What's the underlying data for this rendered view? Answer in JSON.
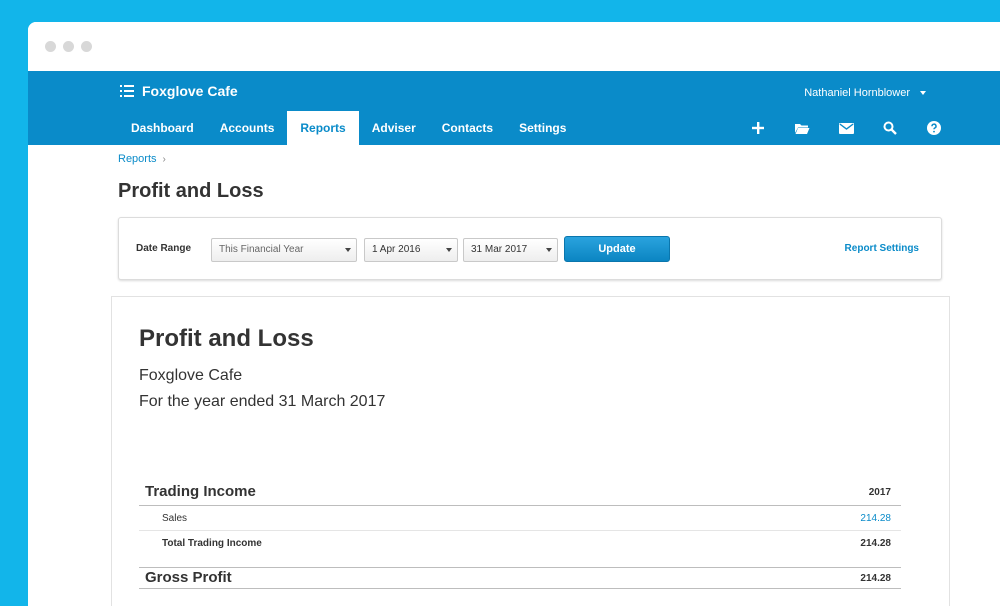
{
  "app": {
    "org_name": "Foxglove Cafe",
    "user_name": "Nathaniel Hornblower"
  },
  "nav": {
    "items": [
      {
        "label": "Dashboard"
      },
      {
        "label": "Accounts"
      },
      {
        "label": "Reports"
      },
      {
        "label": "Adviser"
      },
      {
        "label": "Contacts"
      },
      {
        "label": "Settings"
      }
    ],
    "active": "Reports",
    "icons": [
      "plus-icon",
      "folder-icon",
      "mail-icon",
      "search-icon",
      "help-icon"
    ]
  },
  "breadcrumb": {
    "item": "Reports",
    "separator": "›"
  },
  "page": {
    "title": "Profit and Loss"
  },
  "filters": {
    "date_range_label": "Date Range",
    "range_value": "This Financial Year",
    "from_value": "1 Apr 2016",
    "to_value": "31 Mar 2017",
    "update_label": "Update",
    "report_settings_label": "Report Settings"
  },
  "report": {
    "title": "Profit and Loss",
    "org": "Foxglove Cafe",
    "period": "For the year ended 31 March 2017",
    "trading_income": {
      "label": "Trading Income",
      "year": "2017",
      "rows": [
        {
          "label": "Sales",
          "value": "214.28"
        }
      ],
      "total": {
        "label": "Total Trading Income",
        "value": "214.28"
      }
    },
    "gross_profit": {
      "label": "Gross Profit",
      "value": "214.28"
    }
  },
  "colors": {
    "background": "#12b5ea",
    "header": "#0a8bc9",
    "link": "#0a8bc9"
  }
}
